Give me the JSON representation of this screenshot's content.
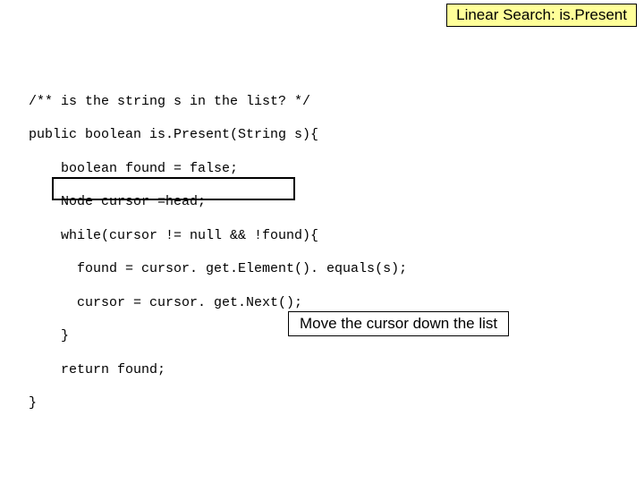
{
  "title": "Linear Search: is.Present",
  "code": {
    "l0": "/** is the string s in the list? */",
    "l1": "public boolean is.Present(String s){",
    "l2": "    boolean found = false;",
    "l3": "    Node cursor =head;",
    "l4": "    while(cursor != null && !found){",
    "l5": "      found = cursor. get.Element(). equals(s);",
    "l6": "      cursor = cursor. get.Next();",
    "l7": "    }",
    "l8": "    return found;",
    "l9": "}"
  },
  "caption": "Move the cursor down the list"
}
